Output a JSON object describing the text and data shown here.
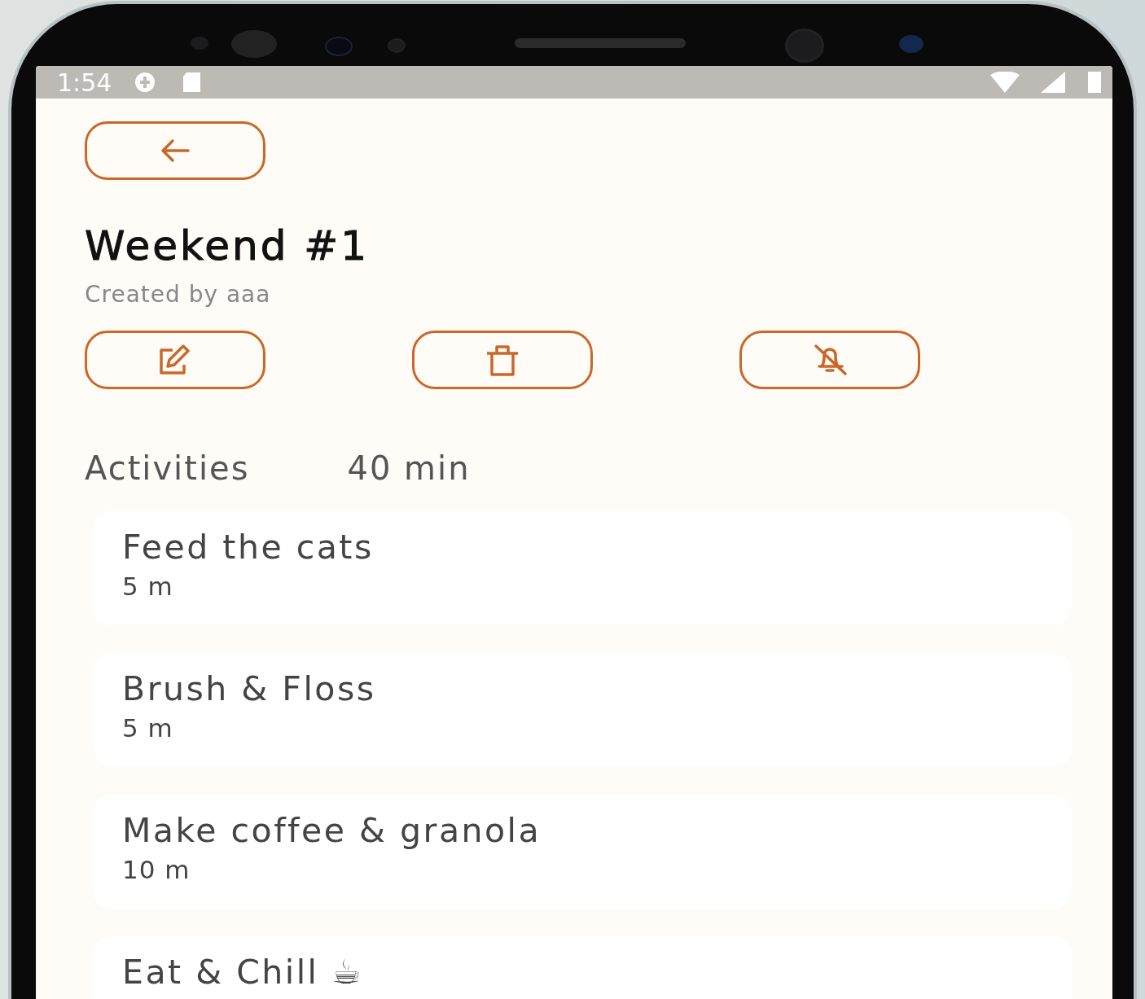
{
  "status_bar": {
    "time": "1:54"
  },
  "header": {
    "title": "Weekend #1",
    "subtitle": "Created by aaa"
  },
  "activities": {
    "label": "Activities",
    "total": "40 min",
    "items": [
      {
        "title": "Feed the cats",
        "duration": "5 m"
      },
      {
        "title": "Brush & Floss",
        "duration": "5 m"
      },
      {
        "title": "Make coffee & granola",
        "duration": "10 m"
      },
      {
        "title": "Eat & Chill ☕"
      }
    ]
  }
}
